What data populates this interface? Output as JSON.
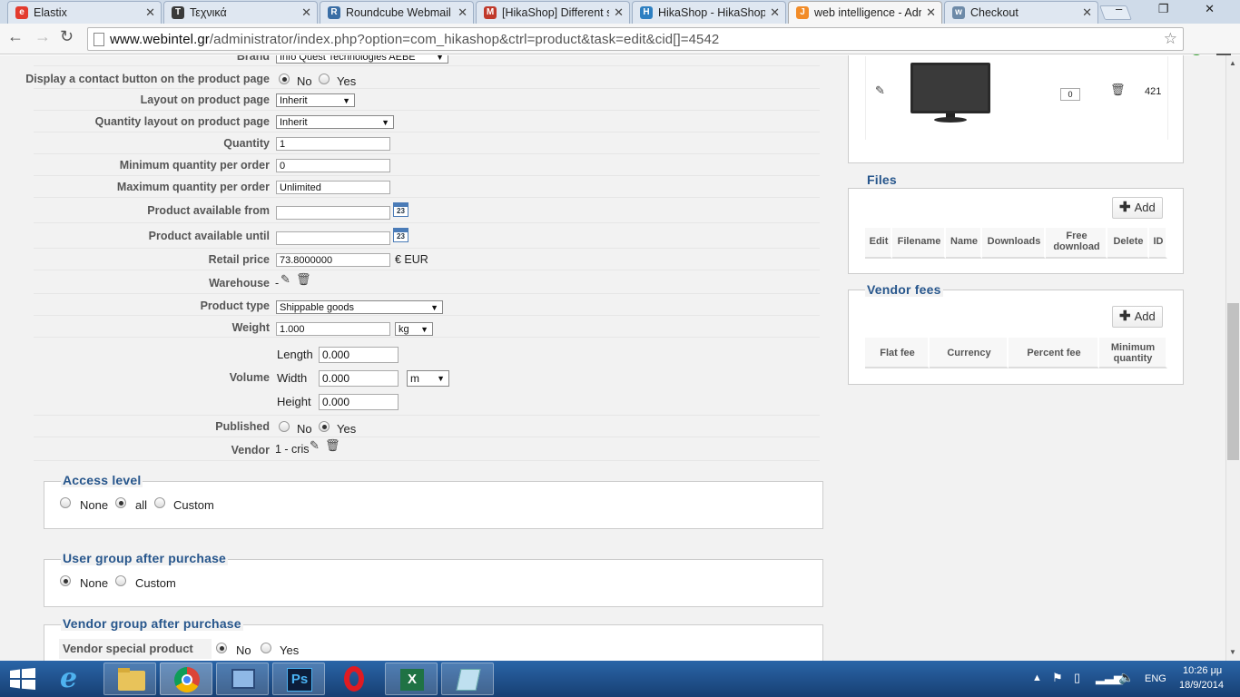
{
  "browser": {
    "tabs": [
      {
        "title": "Elastix",
        "color": "#e33b2e",
        "glyph": "e"
      },
      {
        "title": "Τεχνικά",
        "color": "#3a3a3a",
        "glyph": "T"
      },
      {
        "title": "Roundcube Webmail :",
        "color": "#3a6ea5",
        "glyph": "R"
      },
      {
        "title": "[HikaShop] Different s",
        "color": "#c0392b",
        "glyph": "M"
      },
      {
        "title": "HikaShop - HikaShop",
        "color": "#2d7fc1",
        "glyph": "H"
      },
      {
        "title": "web intelligence - Adr",
        "color": "#f28c28",
        "glyph": "J"
      },
      {
        "title": "Checkout",
        "color": "#6d8aa8",
        "glyph": "w"
      }
    ],
    "url_domain": "www.webintel.gr",
    "url_path": "/administrator/index.php?option=com_hikashop&ctrl=product&task=edit&cid[]=4542",
    "window_buttons": "– ❐ ✕"
  },
  "form": {
    "brand": {
      "label": "Brand",
      "value": "Info Quest Technologies AEBE"
    },
    "contact_button": {
      "label": "Display a contact button on the product page",
      "no": "No",
      "yes": "Yes"
    },
    "layout": {
      "label": "Layout on product page",
      "value": "Inherit"
    },
    "quantity_layout": {
      "label": "Quantity layout on product page",
      "value": "Inherit"
    },
    "quantity": {
      "label": "Quantity",
      "value": "1"
    },
    "min_qty": {
      "label": "Minimum quantity per order",
      "value": "0"
    },
    "max_qty": {
      "label": "Maximum quantity per order",
      "value": "Unlimited"
    },
    "available_from": {
      "label": "Product available from",
      "value": "",
      "cal": "23"
    },
    "available_until": {
      "label": "Product available until",
      "value": "",
      "cal": "23"
    },
    "retail_price": {
      "label": "Retail price",
      "value": "73.8000000",
      "currency": "€ EUR"
    },
    "warehouse": {
      "label": "Warehouse",
      "value": "-"
    },
    "product_type": {
      "label": "Product type",
      "value": "Shippable goods"
    },
    "weight": {
      "label": "Weight",
      "value": "1.000",
      "unit": "kg"
    },
    "volume": {
      "label": "Volume",
      "length_label": "Length",
      "length": "0.000",
      "width_label": "Width",
      "width": "0.000",
      "height_label": "Height",
      "height": "0.000",
      "unit": "m"
    },
    "published": {
      "label": "Published",
      "no": "No",
      "yes": "Yes"
    },
    "vendor": {
      "label": "Vendor",
      "value": "1 - cris"
    }
  },
  "access_level": {
    "title": "Access level",
    "none": "None",
    "all": "all",
    "custom": "Custom"
  },
  "user_group": {
    "title": "User group after purchase",
    "none": "None",
    "custom": "Custom"
  },
  "vendor_group": {
    "title": "Vendor group after purchase",
    "special_label": "Vendor special product",
    "no": "No",
    "yes": "Yes"
  },
  "images_panel": {
    "ordering": "0",
    "id": "421"
  },
  "files_panel": {
    "title": "Files",
    "add": "Add",
    "columns": [
      "Edit",
      "Filename",
      "Name",
      "Downloads",
      "Free download",
      "Delete",
      "ID"
    ]
  },
  "vendor_fees_panel": {
    "title": "Vendor fees",
    "add": "Add",
    "columns": [
      "Flat fee",
      "Currency",
      "Percent fee",
      "Minimum quantity"
    ]
  },
  "taskbar": {
    "lang": "ENG",
    "time": "10:26 μμ",
    "date": "18/9/2014"
  }
}
